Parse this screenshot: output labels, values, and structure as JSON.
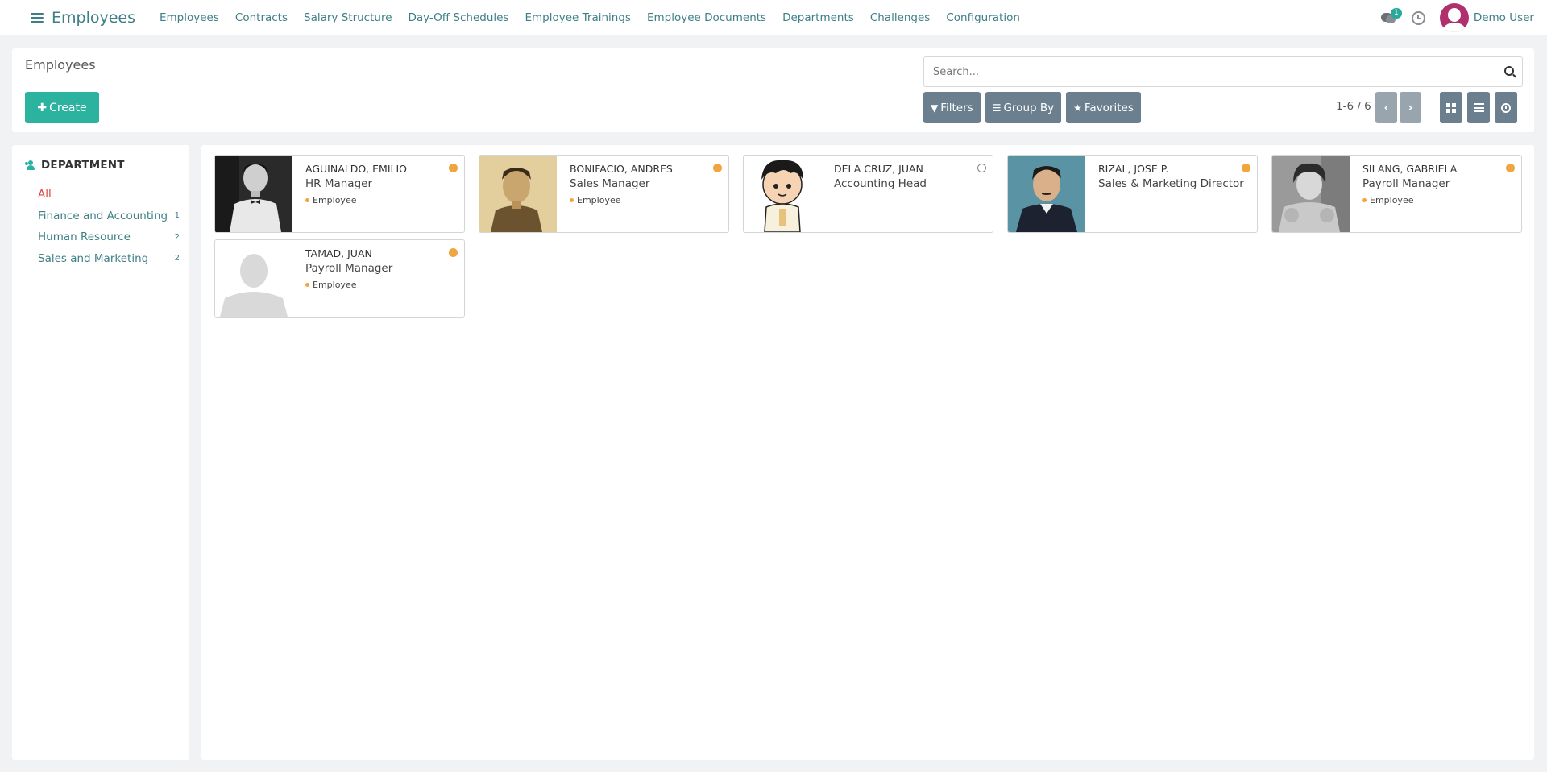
{
  "app": {
    "title": "Employees"
  },
  "nav": [
    "Employees",
    "Contracts",
    "Salary Structure",
    "Day-Off Schedules",
    "Employee Trainings",
    "Employee Documents",
    "Departments",
    "Challenges",
    "Configuration"
  ],
  "user": {
    "name": "Demo User",
    "message_count": "1",
    "avatar_color": "#b0306e"
  },
  "breadcrumb": "Employees",
  "create_label": "Create",
  "search": {
    "placeholder": "Search..."
  },
  "filters": {
    "filters": "Filters",
    "group_by": "Group By",
    "favorites": "Favorites"
  },
  "pager": "1-6 / 6",
  "sidebar": {
    "title": "DEPARTMENT",
    "items": [
      {
        "label": "All",
        "count": ""
      },
      {
        "label": "Finance and Accounting",
        "count": "1"
      },
      {
        "label": "Human Resource",
        "count": "2"
      },
      {
        "label": "Sales and Marketing",
        "count": "2"
      }
    ]
  },
  "employees": [
    {
      "name": "AGUINALDO, EMILIO",
      "job": "HR Manager",
      "tag": "Employee",
      "status": "away"
    },
    {
      "name": "BONIFACIO, ANDRES",
      "job": "Sales Manager",
      "tag": "Employee",
      "status": "away"
    },
    {
      "name": "DELA CRUZ, JUAN",
      "job": "Accounting Head",
      "tag": "",
      "status": "offline"
    },
    {
      "name": "RIZAL, JOSE P.",
      "job": "Sales & Marketing Director",
      "tag": "",
      "status": "away"
    },
    {
      "name": "SILANG, GABRIELA",
      "job": "Payroll Manager",
      "tag": "Employee",
      "status": "away"
    },
    {
      "name": "TAMAD, JUAN",
      "job": "Payroll Manager",
      "tag": "Employee",
      "status": "away"
    }
  ],
  "colors": {
    "accent": "#3e7f86",
    "create": "#2bb39f",
    "button": "#6b7f8e",
    "status_away": "#f0a540",
    "active_filter": "#d9453f"
  }
}
